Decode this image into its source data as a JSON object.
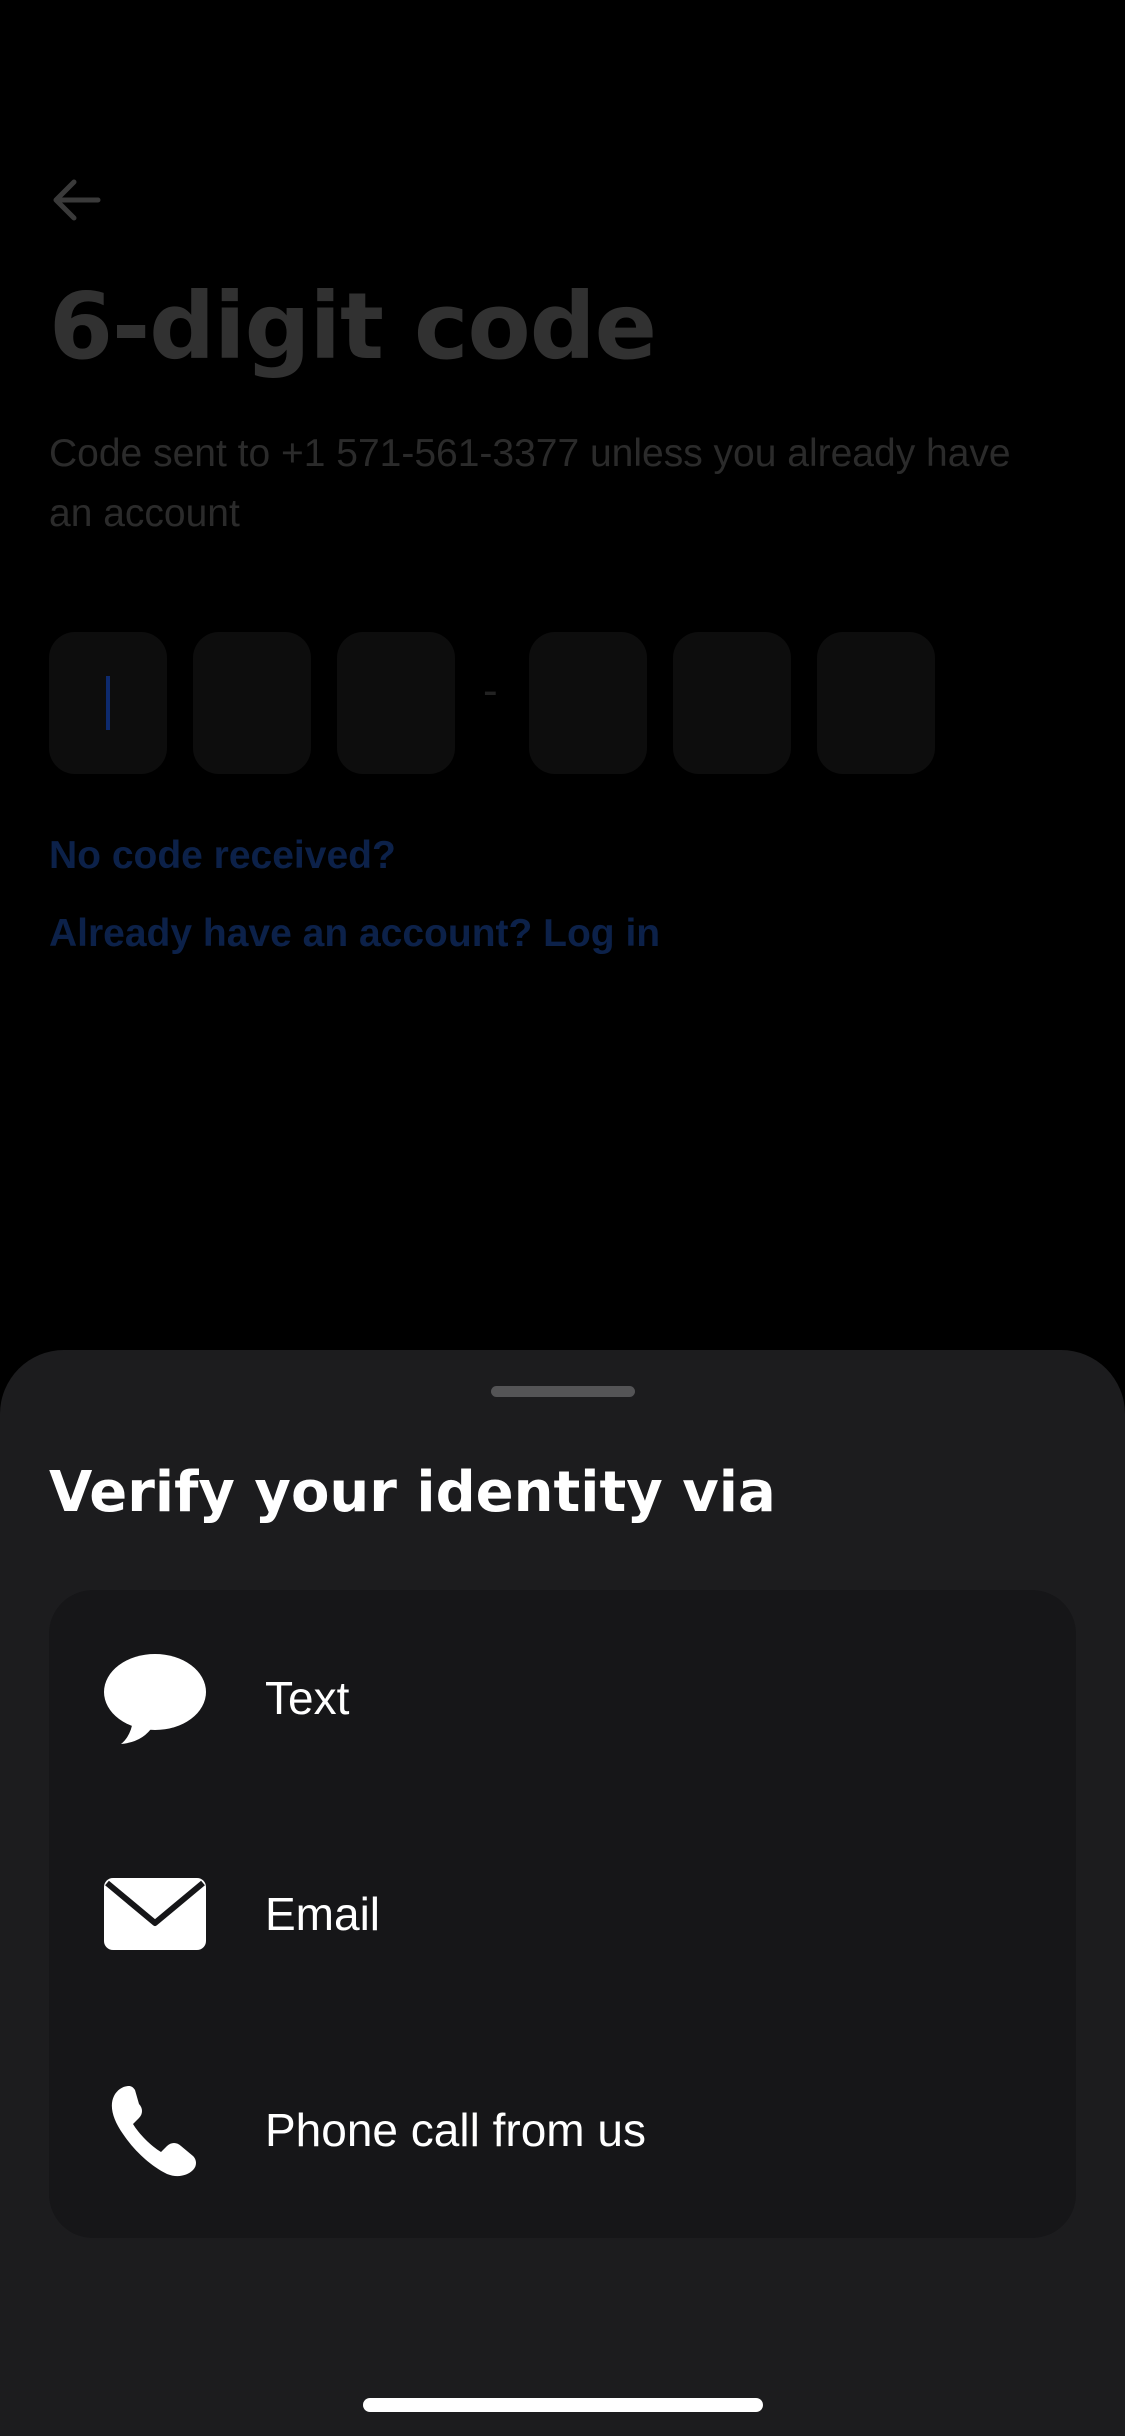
{
  "background_page": {
    "title": "6-digit code",
    "subtitle": "Code sent to +1 571-561-3377 unless you already have an account",
    "code_separator": "-",
    "no_code_link": "No code received?",
    "login_link": "Already have an account? Log in",
    "back_icon": "arrow-left-icon"
  },
  "sheet": {
    "title": "Verify your identity via",
    "options": [
      {
        "label": "Text",
        "icon": "chat-bubble-icon"
      },
      {
        "label": "Email",
        "icon": "envelope-icon"
      },
      {
        "label": "Phone call from us",
        "icon": "phone-icon"
      }
    ]
  },
  "colors": {
    "screen_bg": "#000000",
    "sheet_bg": "#1c1c1e",
    "options_bg": "#161618",
    "link_dimmed": "#0c2149",
    "title_dimmed": "#313131"
  }
}
